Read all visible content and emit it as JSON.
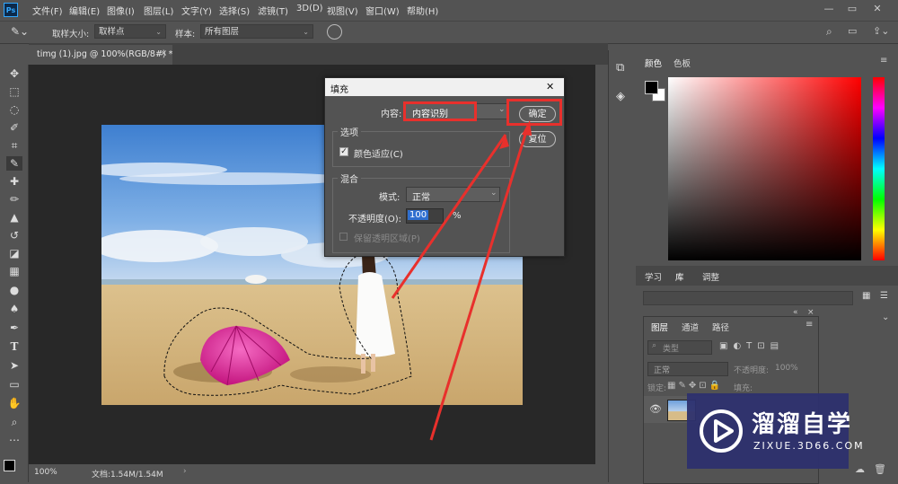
{
  "app": {
    "logo": "Ps",
    "menu": [
      "文件(F)",
      "编辑(E)",
      "图像(I)",
      "图层(L)",
      "文字(Y)",
      "选择(S)",
      "滤镜(T)",
      "3D(D)",
      "视图(V)",
      "窗口(W)",
      "帮助(H)"
    ],
    "window_buttons": {
      "minimize": "—",
      "restore": "▭",
      "close": "✕"
    }
  },
  "options_bar": {
    "sample_size_label": "取样大小:",
    "sample_size_value": "取样点",
    "sample_label": "样本:",
    "sample_value": "所有图层"
  },
  "document": {
    "tab_title": "timg (1).jpg @ 100%(RGB/8#) *",
    "tab_close": "×",
    "zoom": "100%",
    "doc_size": "文档:1.54M/1.54M",
    "status_arrow": "›"
  },
  "fill_dialog": {
    "title": "填充",
    "close": "✕",
    "content_label": "内容:",
    "content_value": "内容识别",
    "ok_label": "确定",
    "reset_label": "复位",
    "options_group": "选项",
    "color_adapt_label": "颜色适应(C)",
    "color_adapt_checked": true,
    "blend_group": "混合",
    "mode_label": "模式:",
    "mode_value": "正常",
    "opacity_label": "不透明度(O):",
    "opacity_value": "100",
    "opacity_unit": "%",
    "preserve_transparency_label": "保留透明区域(P)",
    "highlight_color": "#e8302c"
  },
  "right_panels": {
    "color_tabs": [
      "颜色",
      "色板"
    ],
    "library_tabs": [
      "学习",
      "库",
      "调整"
    ],
    "layers_tabs": [
      "图层",
      "通道",
      "路径"
    ],
    "layers_search_placeholder": "类型",
    "blend_mode": "正常",
    "opacity_label": "不透明度:",
    "opacity_value": "100%",
    "lock_label": "锁定:",
    "fill_label": "填充:"
  },
  "watermark": {
    "title": "溜溜自学",
    "url": "ZIXUE.3D66.COM"
  },
  "tools": [
    "move-tool",
    "marquee-tool",
    "lasso-tool",
    "quick-select-tool",
    "crop-tool",
    "eyedropper-tool",
    "healing-tool",
    "brush-tool",
    "stamp-tool",
    "history-brush-tool",
    "eraser-tool",
    "gradient-tool",
    "blur-tool",
    "dodge-tool",
    "pen-tool",
    "type-tool",
    "path-select-tool",
    "shape-tool",
    "hand-tool",
    "zoom-tool",
    "more-tools"
  ]
}
